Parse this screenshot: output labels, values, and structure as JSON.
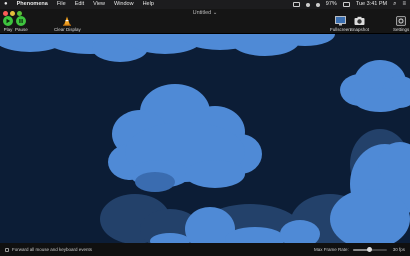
{
  "menubar": {
    "app_name": "Phenomena",
    "items": [
      "File",
      "Edit",
      "View",
      "Window",
      "Help"
    ],
    "battery": "97%",
    "clock": "Tue 3:41 PM"
  },
  "window": {
    "title": "Untitled ⌄"
  },
  "toolbar": {
    "play_label": "Play",
    "pause_label": "Pause",
    "clear_display_label": "Clear Display",
    "fullscreen_label": "Fullscreen",
    "snapshot_label": "Snapshot",
    "settings_label": "Settings",
    "play_color": "#3ec43e",
    "pause_color": "#3ec43e",
    "cone_color": "#f0a020"
  },
  "canvas": {
    "background": "#0c1d36",
    "cloud_color": "#4f8ad6",
    "cloud_dim_color": "#23416a"
  },
  "bottombar": {
    "forward_events_label": "Forward all mouse and keyboard events",
    "forward_events_checked": false,
    "max_frame_rate_label": "Max Frame Rate:",
    "frame_rate_value": "30 fps",
    "frame_rate_fraction": 0.5
  }
}
